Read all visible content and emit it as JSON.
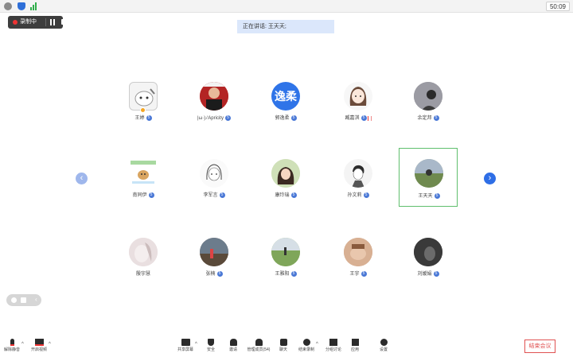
{
  "topbar": {
    "timer": "50:09",
    "icons": [
      "info-icon",
      "shield-icon",
      "signal-icon"
    ]
  },
  "recording": {
    "label": "录制中",
    "icons": [
      "record-dot-icon",
      "pause-icon",
      "stop-icon"
    ]
  },
  "speaking": {
    "text": "正在讲话: 王天天;"
  },
  "nav": {
    "prev": "‹",
    "next": "›"
  },
  "participants": [
    {
      "name": "王婷",
      "badge": "5"
    },
    {
      "name": "|ω·)ﾉApricity",
      "badge": "5"
    },
    {
      "name": "郭逸柔",
      "badge": "5",
      "avatar_text": "逸柔"
    },
    {
      "name": "臧嘉淇",
      "badge": "5"
    },
    {
      "name": "余定邦",
      "badge": "5"
    },
    {
      "name": "南同伊",
      "badge": "5"
    },
    {
      "name": "李军言",
      "badge": "5"
    },
    {
      "name": "康玲瑞",
      "badge": "5"
    },
    {
      "name": "孙文莉",
      "badge": "5"
    },
    {
      "name": "王天天",
      "badge": "5"
    },
    {
      "name": "殷宇慧",
      "badge": ""
    },
    {
      "name": "张楠",
      "badge": "5"
    },
    {
      "name": "王雅阳",
      "badge": "5"
    },
    {
      "name": "王宇",
      "badge": "5"
    },
    {
      "name": "刘嫒娟",
      "badge": "5"
    }
  ],
  "colors": {
    "accent": "#2e6ee6",
    "active_border": "#5fbf6d",
    "end": "#e05252",
    "speaking_bg": "#dbe7fb"
  },
  "toolbar": {
    "mute": "解除静音",
    "video": "开启视频",
    "share": "共享屏幕",
    "security": "安全",
    "invite": "邀请",
    "manage": "管理成员(54)",
    "chat": "聊天",
    "record": "结束录制",
    "breakout": "分组讨论",
    "apps": "应用",
    "settings": "设置",
    "end": "结束会议"
  }
}
